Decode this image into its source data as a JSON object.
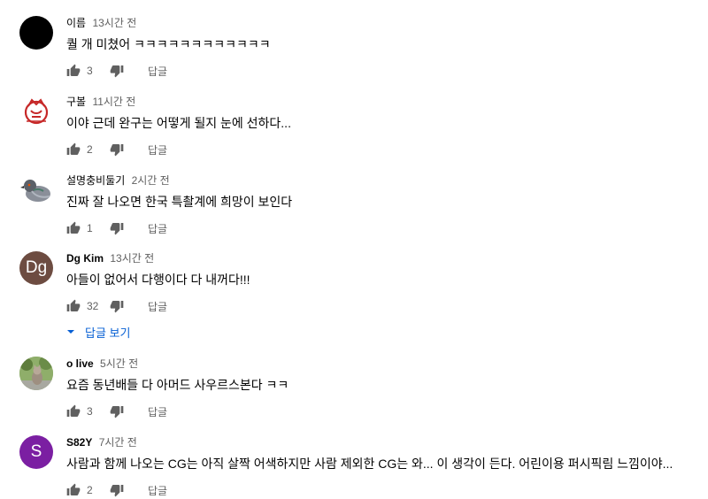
{
  "comments": [
    {
      "author": "이름",
      "time": "13시간 전",
      "text": "퀄 개 미쳤어 ㅋㅋㅋㅋㅋㅋㅋㅋㅋㅋㅋㅋ",
      "likes": "3",
      "reply_label": "답글",
      "avatar_color": "#000000",
      "avatar_letter": ""
    },
    {
      "author": "구볼",
      "time": "11시간 전",
      "text": "이야 근데 완구는 어떻게 될지 눈에 선하다...",
      "likes": "2",
      "reply_label": "답글",
      "avatar_color": "#ffffff",
      "avatar_letter": ""
    },
    {
      "author": "설명충비둘기",
      "time": "2시간 전",
      "text": "진짜 잘 나오면 한국 특촬계에 희망이 보인다",
      "likes": "1",
      "reply_label": "답글",
      "avatar_color": "#ffffff",
      "avatar_letter": ""
    },
    {
      "author": "Dg Kim",
      "time": "13시간 전",
      "text": "아들이 없어서 다행이다 다 내꺼다!!!",
      "likes": "32",
      "reply_label": "답글",
      "avatar_color": "#6d4c41",
      "avatar_letter": "Dg",
      "view_replies": "답글 보기"
    },
    {
      "author": "o live",
      "time": "5시간 전",
      "text": "요즘 동년배들 다 아머드 사우르스본다 ㅋㅋ",
      "likes": "3",
      "reply_label": "답글",
      "avatar_color": "#7a9a5a",
      "avatar_letter": ""
    },
    {
      "author": "S82Y",
      "time": "7시간 전",
      "text": "사람과 함께 나오는 CG는 아직 살짝 어색하지만 사람 제외한 CG는 와... 이 생각이 든다. 어린이용 퍼시픽림 느낌이야...",
      "likes": "2",
      "reply_label": "답글",
      "avatar_color": "#7b1fa2",
      "avatar_letter": "S"
    }
  ],
  "colors": {
    "text_primary": "#030303",
    "text_secondary": "#606060",
    "link_blue": "#065fd4"
  },
  "icons": {
    "like": "thumb-up-icon",
    "dislike": "thumb-down-icon",
    "expand": "caret-down-icon"
  }
}
